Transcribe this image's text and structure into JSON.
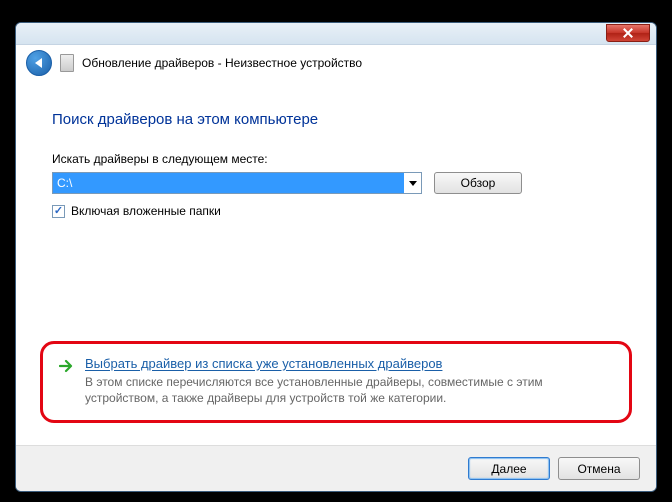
{
  "window": {
    "title": "Обновление драйверов - Неизвестное устройство"
  },
  "content": {
    "heading": "Поиск драйверов на этом компьютере",
    "search_label": "Искать драйверы в следующем месте:",
    "path_value": "C:\\",
    "browse_label": "Обзор",
    "include_subfolders_label": "Включая вложенные папки",
    "include_subfolders_checked": true
  },
  "command": {
    "title": "Выбрать драйвер из списка уже установленных драйверов",
    "description": "В этом списке перечисляются все установленные драйверы, совместимые с этим устройством, а также драйверы для устройств той же категории."
  },
  "footer": {
    "next_label": "Далее",
    "cancel_label": "Отмена"
  }
}
